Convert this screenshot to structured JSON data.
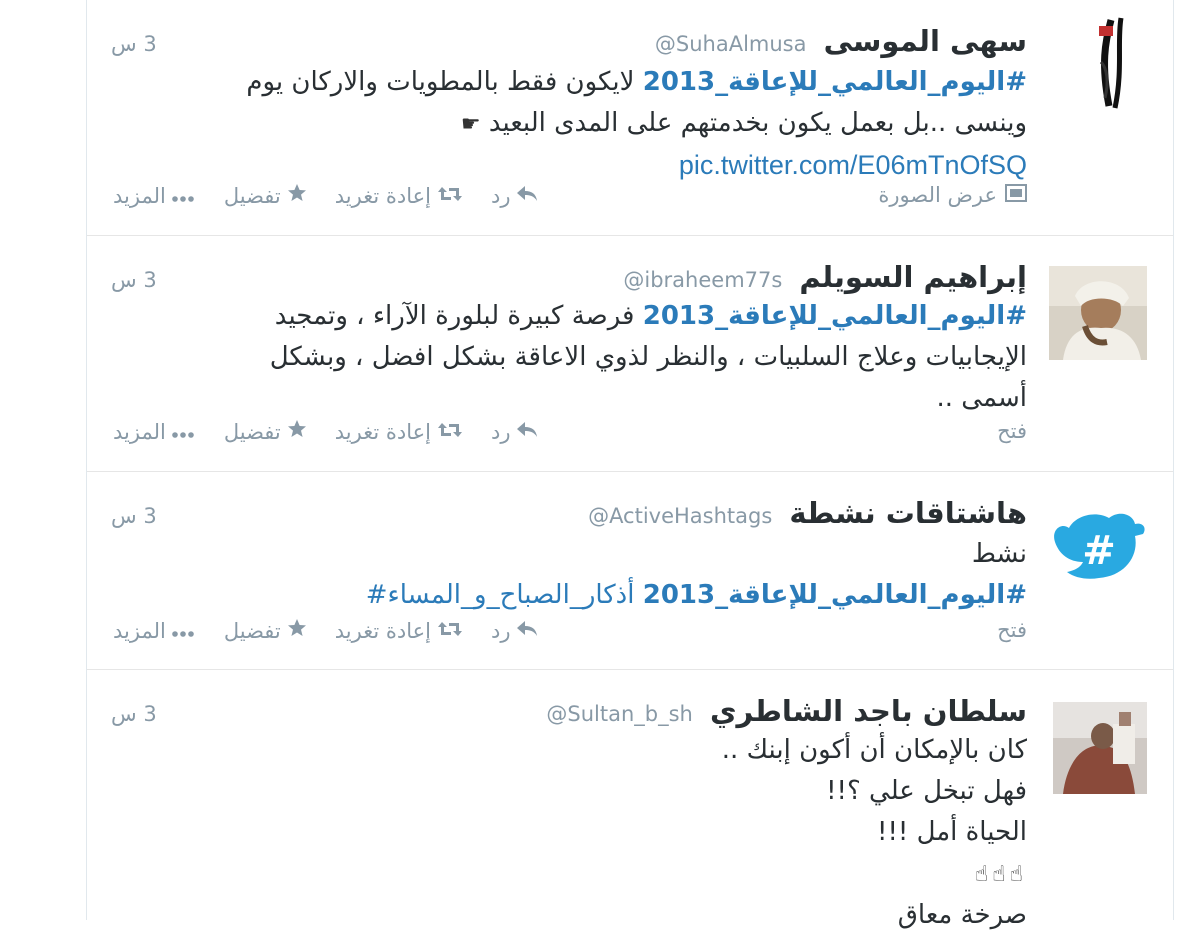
{
  "tweets": [
    {
      "fullname": "سهى الموسى",
      "username": "@SuhaAlmusa",
      "time": "3 س",
      "hashtag": "#اليوم_العالمي_للإعاقة_2013",
      "text1": " لايكون فقط بالمطويات والاركان يوم",
      "line2": "وينسى ..بل بعمل يكون بخدمتهم على المدى البعيد",
      "line2_icon": "☛",
      "link": "pic.twitter.com/E06mTnOfSQ",
      "details_label": "عرض الصورة",
      "details_icon": "photo-icon"
    },
    {
      "fullname": "إبراهيم السويلم",
      "username": "@ibraheem77s",
      "time": "3 س",
      "hashtag": "#اليوم_العالمي_للإعاقة_2013",
      "text1": " فرصة كبيرة لبلورة الآراء ، وتمجيد",
      "line2": "الإيجابيات وعلاج السلبيات ، والنظر لذوي الاعاقة بشكل افضل ، وبشكل",
      "line3": "أسمى ..",
      "details_label": "فتح"
    },
    {
      "fullname": "هاشتاقات نشطة",
      "username": "@ActiveHashtags",
      "time": "3 س",
      "line1": "نشط",
      "hashtag": "#اليوم_العالمي_للإعاقة_2013",
      "hashtag2": " أذكار_الصباح_و_المساء#",
      "details_label": "فتح"
    },
    {
      "fullname": "سلطان باجد الشاطري",
      "username": "@Sultan_b_sh",
      "time": "3 س",
      "line1": "كان بالإمكان أن أكون إبنك ..",
      "line2": "فهل تبخل علي ؟!!",
      "line3": "الحياة أمل !!!",
      "line4": "☝☝☝",
      "line5": "صرخة معاق"
    }
  ],
  "actions": {
    "reply": "رد",
    "retweet": "إعادة تغريد",
    "favorite": "تفضيل",
    "more": "المزيد"
  },
  "icons": {
    "reply": "reply-arrow-icon",
    "retweet": "retweet-icon",
    "favorite": "star-icon",
    "more": "ellipsis-icon"
  },
  "colors": {
    "hashtag": "#2b7bb9",
    "meta": "#8899a6",
    "text": "#292f33",
    "twitter_blue": "#29a9e1"
  }
}
